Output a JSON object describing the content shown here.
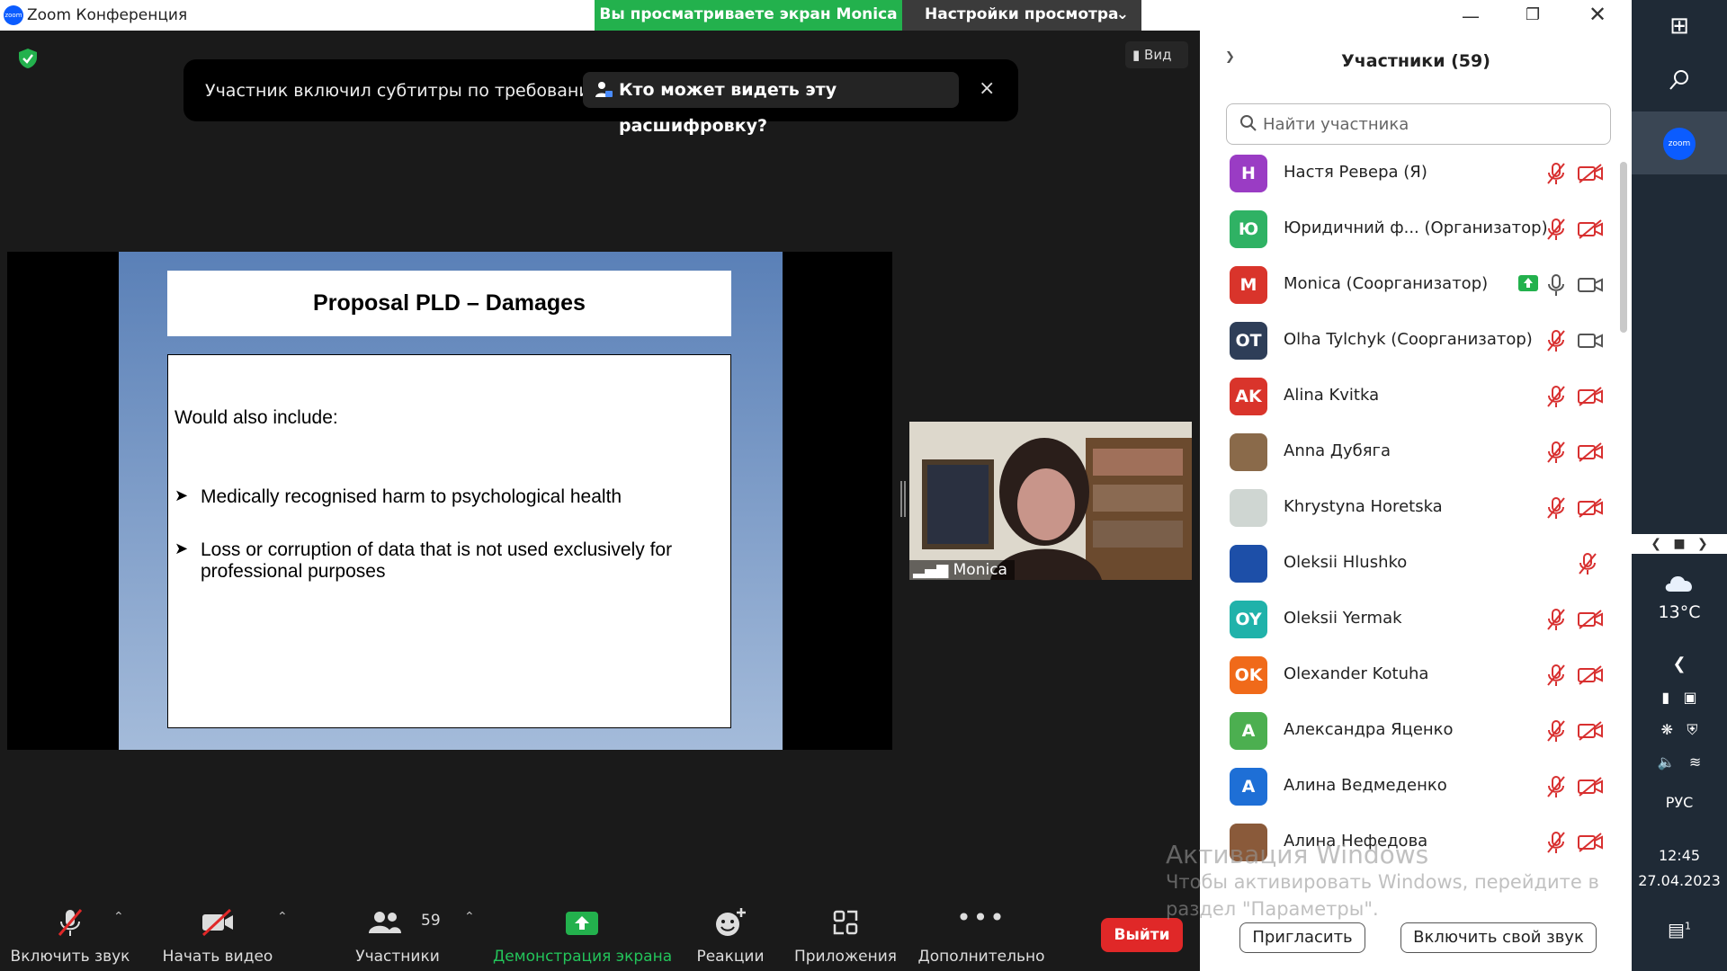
{
  "window": {
    "title": "Zoom Конференция"
  },
  "share_banner": {
    "text": "Вы просматриваете экран Monica",
    "view_settings": "Настройки просмотра"
  },
  "notification": {
    "text": "Участник включил субтитры по требованию",
    "button": "Кто может видеть эту расшифровку?",
    "close": "×"
  },
  "view_button": {
    "label": "Вид"
  },
  "slide": {
    "title": "Proposal PLD – Damages",
    "intro": "Would also include:",
    "bullets": [
      "Medically recognised harm to psychological health",
      "Loss or corruption of data that is not used exclusively for professional purposes"
    ]
  },
  "video": {
    "name": "Monica"
  },
  "toolbar": {
    "unmute": "Включить звук",
    "start_video": "Начать видео",
    "participants": "Участники",
    "participants_count": "59",
    "share_screen": "Демонстрация экрана",
    "reactions": "Реакции",
    "apps": "Приложения",
    "more": "Дополнительно",
    "leave": "Выйти"
  },
  "panel": {
    "title": "Участники (59)",
    "search_placeholder": "Найти участника",
    "invite": "Пригласить",
    "unmute_self": "Включить свой звук"
  },
  "participants": [
    {
      "initials": "Н",
      "name": "Настя Ревера (Я)",
      "color": "#9a3cc4",
      "mic": "muted",
      "cam": "off"
    },
    {
      "initials": "Ю",
      "name": "Юридичний ф...  (Организатор)",
      "color": "#2fb264",
      "mic": "muted",
      "cam": "off"
    },
    {
      "initials": "M",
      "name": "Monica (Соорганизатор)",
      "color": "#d9342b",
      "mic": "on",
      "cam": "on",
      "sharing": true
    },
    {
      "initials": "OT",
      "name": "Olha Tylchyk (Соорганизатор)",
      "color": "#2e3e58",
      "mic": "muted",
      "cam": "on"
    },
    {
      "initials": "AK",
      "name": "Alina Kvitka",
      "color": "#d9342b",
      "mic": "muted",
      "cam": "off"
    },
    {
      "initials": "",
      "name": "Anna Дубяга",
      "color": "#8a6a4a",
      "mic": "muted",
      "cam": "off",
      "photo": true
    },
    {
      "initials": "",
      "name": "Khrystyna Horetska",
      "color": "#cfd6d2",
      "mic": "muted",
      "cam": "off",
      "photo": true
    },
    {
      "initials": "",
      "name": "Oleksii Hlushko",
      "color": "#1d4fa8",
      "mic": "muted",
      "cam": "none",
      "photo": true
    },
    {
      "initials": "OY",
      "name": "Oleksii Yermak",
      "color": "#20b2aa",
      "mic": "muted",
      "cam": "off"
    },
    {
      "initials": "OK",
      "name": "Olexander Kotuha",
      "color": "#f06a1a",
      "mic": "muted",
      "cam": "off"
    },
    {
      "initials": "A",
      "name": "Александра Яценко",
      "color": "#4caf50",
      "mic": "muted",
      "cam": "off"
    },
    {
      "initials": "A",
      "name": "Алина Ведмеденко",
      "color": "#1e6fd6",
      "mic": "muted",
      "cam": "off"
    },
    {
      "initials": "",
      "name": "Алина Нефедова",
      "color": "#8a5a3a",
      "mic": "muted",
      "cam": "off",
      "photo": true
    }
  ],
  "watermark": {
    "line1": "Активация Windows",
    "line2": "Чтобы активировать Windows, перейдите в",
    "line3": "раздел \"Параметры\"."
  },
  "taskbar": {
    "zoom_label": "zoom",
    "temperature": "13°C",
    "language": "РУС",
    "time": "12:45",
    "date": "27.04.2023",
    "notifications": "1"
  }
}
